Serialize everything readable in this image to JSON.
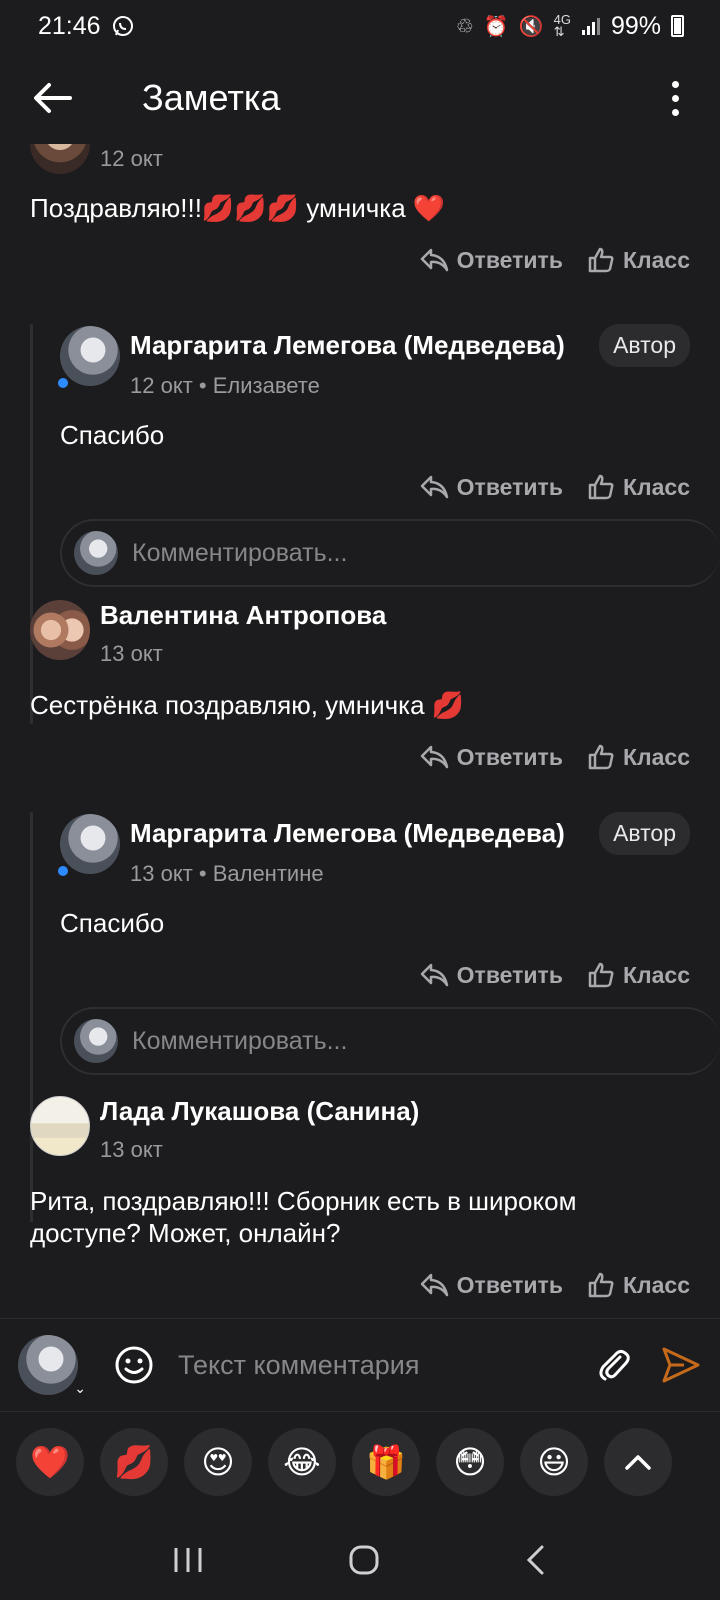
{
  "status_bar": {
    "time": "21:46",
    "battery": "99%"
  },
  "header": {
    "title": "Заметка"
  },
  "comments": [
    {
      "date": "12 окт",
      "text": "Поздравляю!!!💋💋💋 умничка ❤️"
    },
    {
      "name": "Маргарита Лемегова (Медведева)",
      "badge": "Автор",
      "date": "12 окт • Елизавете",
      "text": "Спасибо"
    },
    {
      "name": "Валентина Антропова",
      "date": "13 окт",
      "text": "Сестрёнка поздравляю, умничка 💋"
    },
    {
      "name": "Маргарита Лемегова (Медведева)",
      "badge": "Автор",
      "date": "13 окт • Валентине",
      "text": "Спасибо"
    },
    {
      "name": "Лада Лукашова (Санина)",
      "date": "13 окт",
      "text": "Рита, поздравляю!!! Сборник есть в широком доступе? Может, онлайн?"
    }
  ],
  "actions": {
    "reply": "Ответить",
    "like": "Класс"
  },
  "reply_box": {
    "placeholder": "Комментировать..."
  },
  "composer": {
    "placeholder": "Текст комментария"
  },
  "quick_reactions": [
    "❤️",
    "💋",
    "😍",
    "😂",
    "🎁",
    "😳",
    "😃"
  ]
}
